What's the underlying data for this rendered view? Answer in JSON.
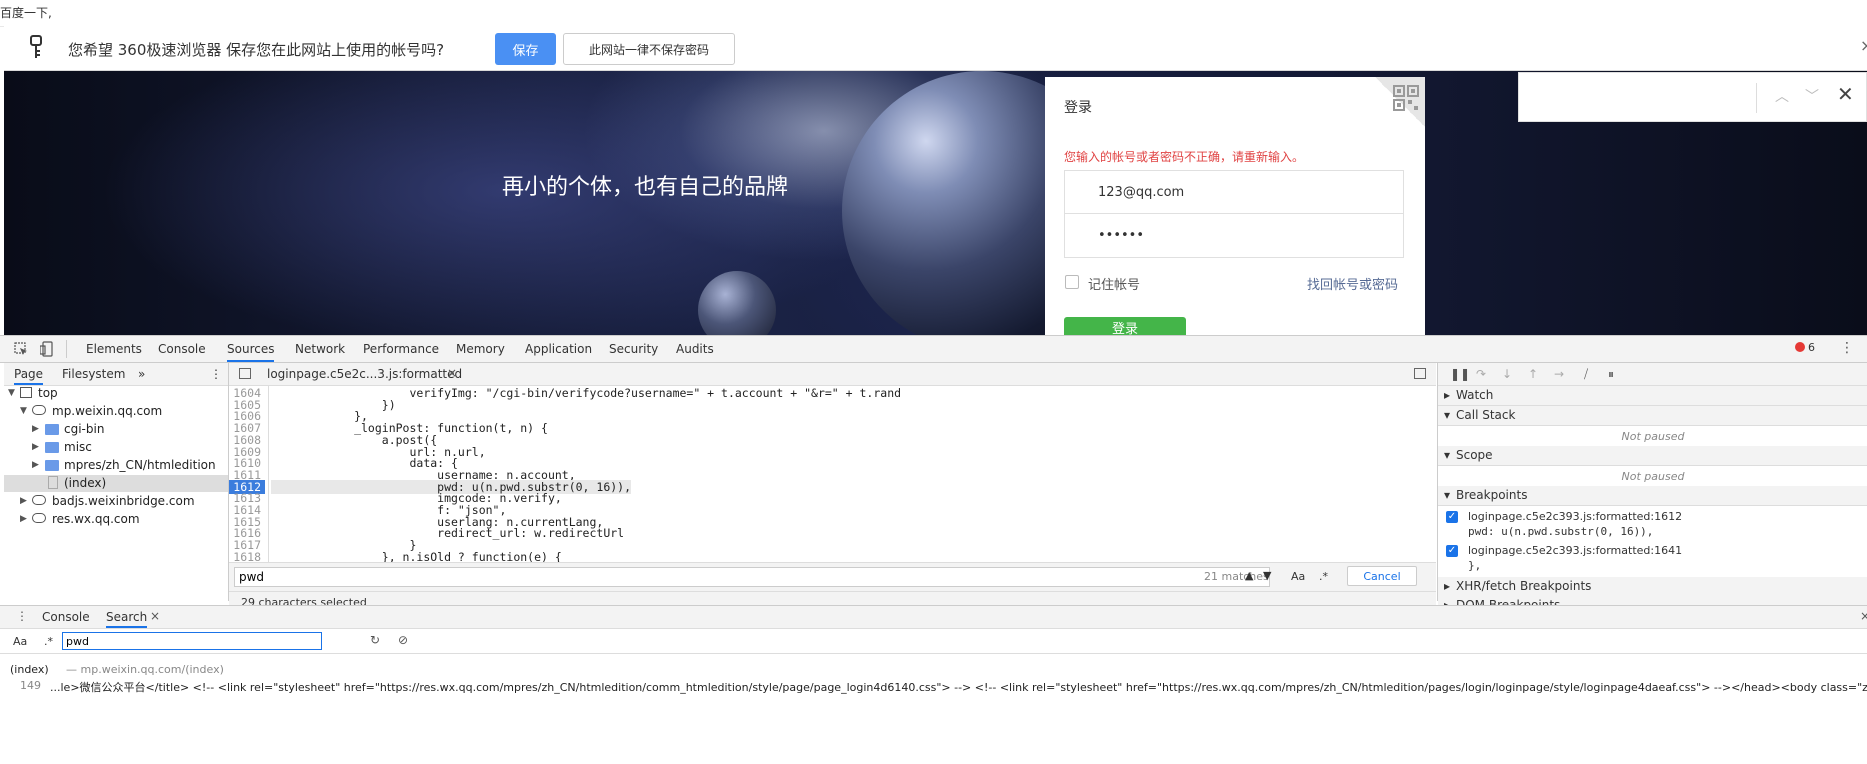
{
  "top_strip": {
    "text": "百度一下,"
  },
  "password_bar": {
    "prompt": "您希望 360极速浏览器 保存您在此网站上使用的帐号吗?",
    "save_label": "保存",
    "never_label": "此网站一律不保存密码",
    "close_glyph": "×",
    "icon": "key-icon"
  },
  "banner": {
    "slogan": "再小的个体，也有自己的品牌"
  },
  "login": {
    "title": "登录",
    "error": "您输入的帐号或者密码不正确，请重新输入。",
    "account_value": "123@qq.com",
    "password_value": "••••••",
    "remember_label": "记住帐号",
    "forgot_label": "找回帐号或密码",
    "button_label": "登录",
    "qr_icon": "qr-code-icon",
    "button_color": "#44b549",
    "error_color": "#e04343"
  },
  "find_bar": {
    "up_glyph": "︿",
    "down_glyph": "﹀",
    "close_glyph": "✕"
  },
  "devtools": {
    "tabs": [
      "Elements",
      "Console",
      "Sources",
      "Network",
      "Performance",
      "Memory",
      "Application",
      "Security",
      "Audits"
    ],
    "active_tab": "Sources",
    "error_count": "6",
    "menu_glyph": "⋮",
    "navigator": {
      "tabs": [
        "Page",
        "Filesystem"
      ],
      "more_glyph": "»",
      "menu_glyph": "⋮",
      "tree": [
        {
          "label": "top"
        },
        {
          "label": "mp.weixin.qq.com"
        },
        {
          "label": "cgi-bin"
        },
        {
          "label": "misc"
        },
        {
          "label": "mpres/zh_CN/htmledition"
        },
        {
          "label": "(index)"
        },
        {
          "label": "badjs.weixinbridge.com"
        },
        {
          "label": "res.wx.qq.com"
        }
      ]
    },
    "editor": {
      "file_tab": "loginpage.c5e2c...3.js:formatted",
      "close_glyph": "×",
      "lines": [
        {
          "num": "1604",
          "code": "                    verifyImg: \"/cgi-bin/verifycode?username=\" + t.account + \"&r=\" + t.rand"
        },
        {
          "num": "1605",
          "code": "                })"
        },
        {
          "num": "1606",
          "code": "            },"
        },
        {
          "num": "1607",
          "code": "            _loginPost: function(t, n) {"
        },
        {
          "num": "1608",
          "code": "                a.post({"
        },
        {
          "num": "1609",
          "code": "                    url: n.url,"
        },
        {
          "num": "1610",
          "code": "                    data: {"
        },
        {
          "num": "1611",
          "code": "                        username: n.account,"
        },
        {
          "num": "1612",
          "code": "                        pwd: u(n.pwd.substr(0, 16)),"
        },
        {
          "num": "1613",
          "code": "                        imgcode: n.verify,"
        },
        {
          "num": "1614",
          "code": "                        f: \"json\","
        },
        {
          "num": "1615",
          "code": "                        userlang: n.currentLang,"
        },
        {
          "num": "1616",
          "code": "                        redirect_url: w.redirectUrl"
        },
        {
          "num": "1617",
          "code": "                    }"
        },
        {
          "num": "1618",
          "code": "                }, n.isOld ? function(e) {"
        }
      ],
      "search_value": "pwd",
      "search_count": "21 matches",
      "case_label": "Aa",
      "regex_label": ".*",
      "cancel_label": "Cancel",
      "status_text": "29 characters selected"
    },
    "debugger": {
      "panes": [
        "Watch",
        "Call Stack",
        "Scope",
        "Breakpoints",
        "XHR/fetch Breakpoints",
        "DOM Breakpoints"
      ],
      "not_paused": "Not paused",
      "breakpoints": [
        {
          "file": "loginpage.c5e2c393.js:formatted:1612",
          "code": "pwd: u(n.pwd.substr(0, 16)),"
        },
        {
          "file": "loginpage.c5e2c393.js:formatted:1641",
          "code": "},"
        }
      ]
    },
    "drawer": {
      "tabs": [
        "Console",
        "Search"
      ],
      "close_glyph": "×",
      "search_value": "pwd",
      "case_label": "Aa",
      "regex_label": ".*",
      "result_file": "(index)",
      "result_url": "— mp.weixin.qq.com/(index)",
      "result_line_num": "149",
      "result_line": "...le>微信公众平台</title>  <!-- <link rel=\"stylesheet\" href=\"https://res.wx.qq.com/mpres/zh_CN/htmledition/comm_htmledition/style/page/page_login4d6140.css\"> -->  <!-- <link rel=\"stylesheet\" href=\"https://res.wx.qq.com/mpres/zh_CN/htmledition/pages/login/loginpage/style/loginpage4daeaf.css\"> --></head><body class=\"zh_CN\">  <"
    }
  }
}
